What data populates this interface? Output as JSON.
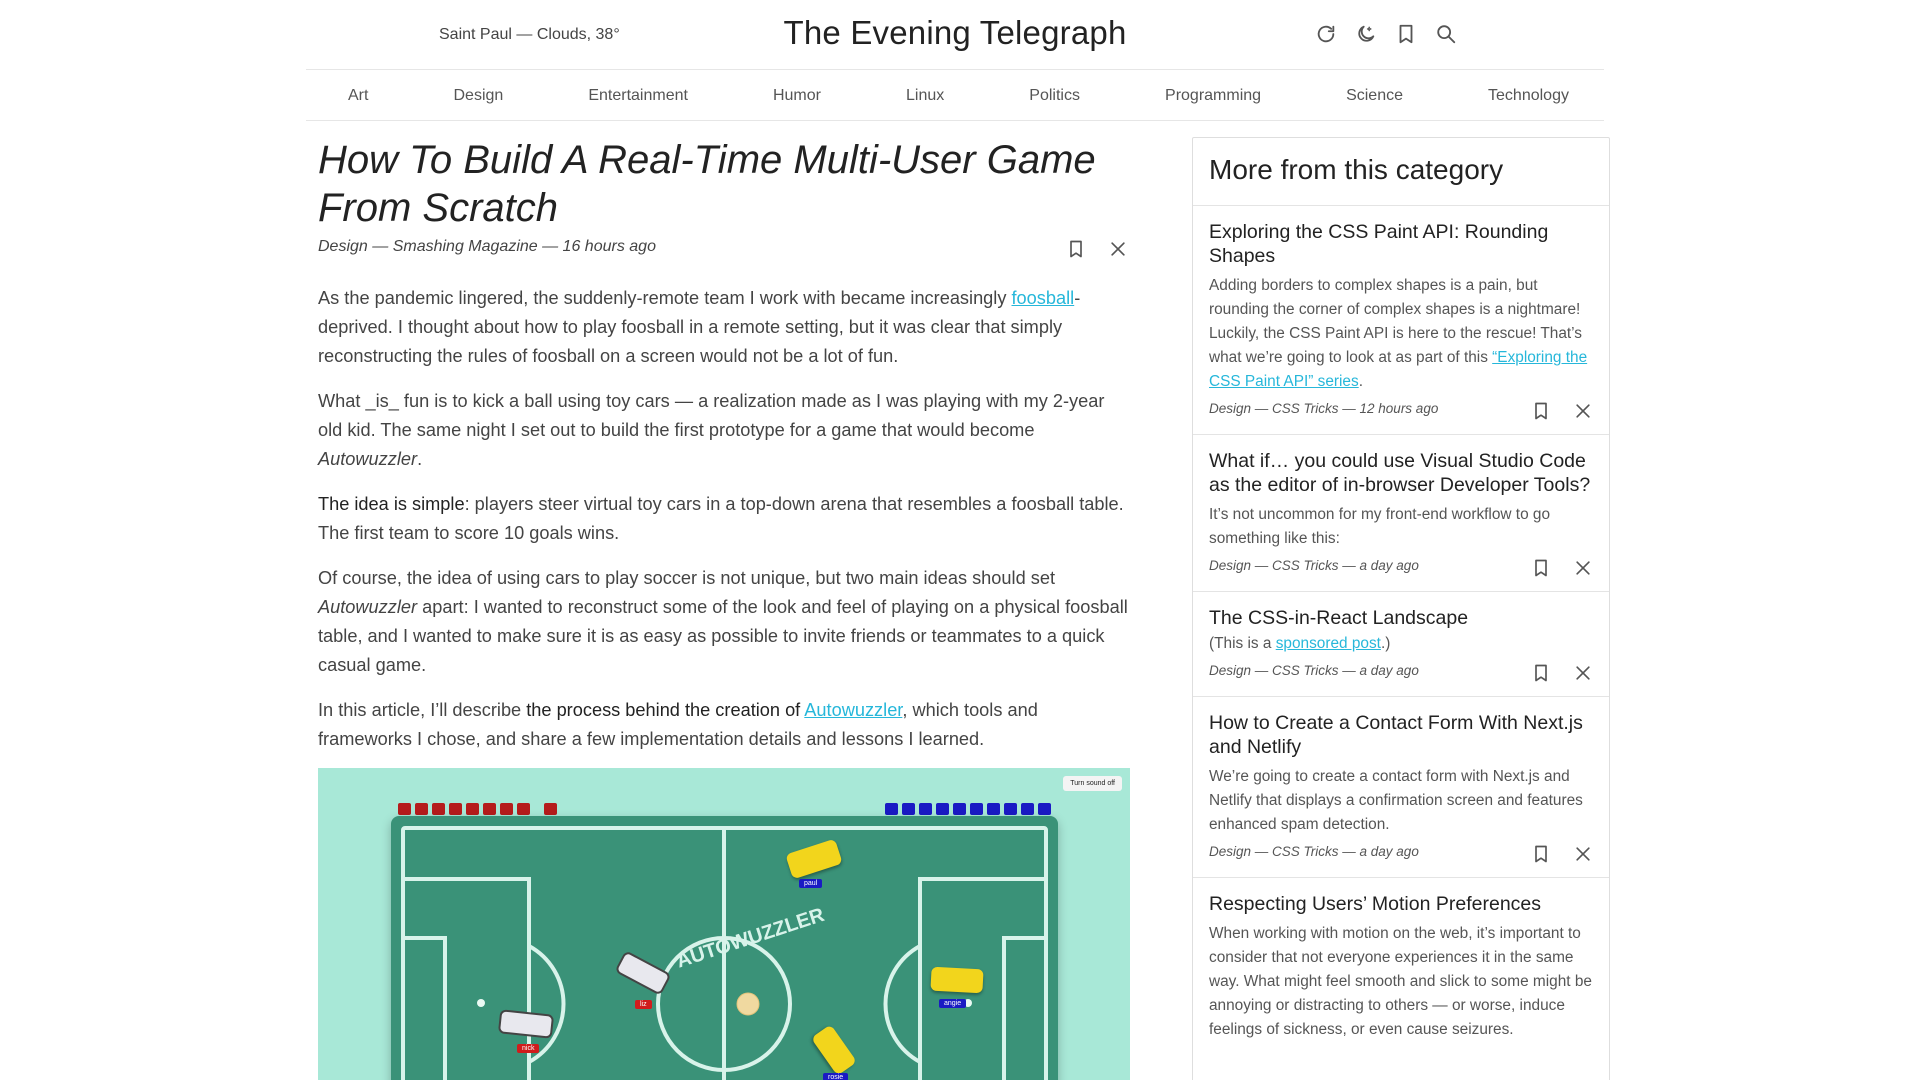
{
  "header": {
    "weather": "Saint Paul — Clouds, 38°",
    "title": "The Evening Telegraph",
    "icons": [
      "refresh-icon",
      "moon-icon",
      "bookmark-icon",
      "search-icon"
    ]
  },
  "nav": {
    "items": [
      "Art",
      "Design",
      "Entertainment",
      "Humor",
      "Linux",
      "Politics",
      "Programming",
      "Science",
      "Technology"
    ]
  },
  "article": {
    "title": "How To Build A Real-Time Multi-User Game From Scratch",
    "meta": "Design — Smashing Magazine — 16 hours ago",
    "p1": {
      "before": "As the pandemic lingered, the suddenly-remote team I work with became increasingly ",
      "link": "foosball",
      "after": "-deprived. I thought about how to play foosball in a remote setting, but it was clear that simply reconstructing the rules of foosball on a screen would not be a lot of fun."
    },
    "p2": {
      "before": "What _is_ fun is to kick a ball using toy cars — a realization made as I was playing with my 2-year old kid. The same night I set out to build the first prototype for a game that would become ",
      "em": "Autowuzzler",
      "after": "."
    },
    "p3": {
      "strong": "The idea is simple",
      "after": ": players steer virtual toy cars in a top-down arena that resembles a foosball table. The first team to score 10 goals wins."
    },
    "p4": {
      "before": "Of course, the idea of using cars to play soccer is not unique, but two main ideas should set ",
      "em": "Autowuzzler",
      "after": " apart: I wanted to reconstruct some of the look and feel of playing on a physical foosball table, and I wanted to make sure it is as easy as possible to invite friends or teammates to a quick casual game."
    },
    "p5": {
      "before": "In this article, I’ll describe ",
      "strong": "the process behind the creation of ",
      "link": "Autowuzzler",
      "after": ", which tools and frameworks I chose, and share a few implementation details and lessons I learned."
    },
    "game": {
      "sound_button": "Turn sound off",
      "logo_text": "AUTOWUZZLER",
      "red_score": 9,
      "blue_score": 10,
      "players": [
        "paul",
        "liz",
        "nick",
        "angie",
        "rosie"
      ],
      "colors": {
        "bg": "#a8e8d7",
        "field": "#3a9278",
        "red": "#b51c1c",
        "blue": "#1a1ac4",
        "yellow_car": "#f2d51c"
      }
    }
  },
  "sidebar": {
    "heading": "More from this category",
    "items": [
      {
        "title": "Exploring the CSS Paint API: Rounding Shapes",
        "desc_before": "Adding borders to complex shapes is a pain, but rounding the corner of complex shapes is a nightmare! Luckily, the CSS Paint API is here to the rescue! That’s what we’re going to look at as part of this ",
        "desc_link": "“Exploring the CSS Paint API” series",
        "desc_after": ".",
        "meta": "Design — CSS Tricks — 12 hours ago"
      },
      {
        "title": "What if… you could use Visual Studio Code as the editor of in-browser Developer Tools?",
        "desc_before": "It’s not uncommon for my front-end workflow to go something like this:",
        "desc_link": "",
        "desc_after": "",
        "meta": "Design — CSS Tricks — a day ago"
      },
      {
        "title": "The CSS-in-React Landscape",
        "desc_before": "(This is a ",
        "desc_link": "sponsored post",
        "desc_after": ".)",
        "meta": "Design — CSS Tricks — a day ago"
      },
      {
        "title": "How to Create a Contact Form With Next.js and Netlify",
        "desc_before": "We’re going to create a contact form with Next.js and Netlify that displays a confirmation screen and features enhanced spam detection.",
        "desc_link": "",
        "desc_after": "",
        "meta": "Design — CSS Tricks — a day ago"
      },
      {
        "title": "Respecting Users’ Motion Preferences",
        "desc_before": "When working with motion on the web, it’s important to consider that not everyone experiences it in the same way. What might feel smooth and slick to some might be annoying or distracting to others — or worse, induce feelings of sickness, or even cause seizures.",
        "desc_link": "",
        "desc_after": "",
        "meta": ""
      }
    ]
  },
  "colors": {
    "link": "#26b7da",
    "text": "#444444",
    "border": "#e4e4e4"
  }
}
